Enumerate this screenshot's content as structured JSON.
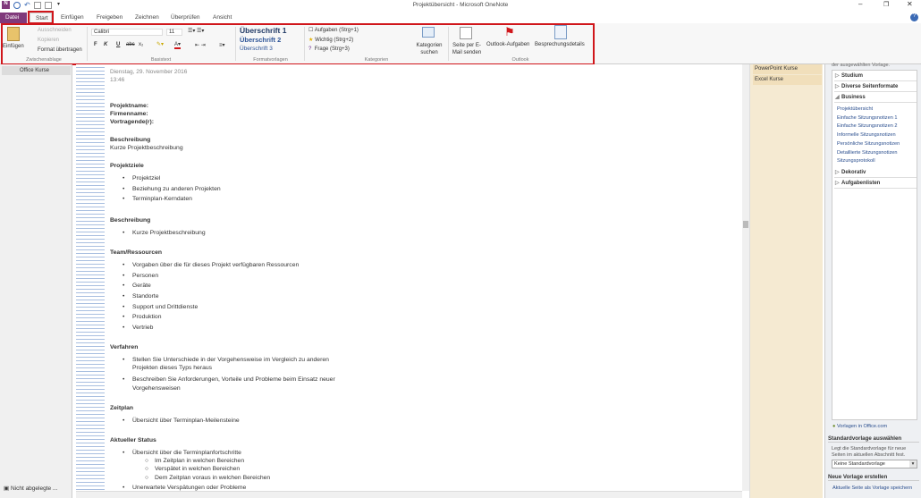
{
  "window": {
    "title": "Projektübersicht - Microsoft OneNote"
  },
  "tabs": [
    {
      "label": "Datei"
    },
    {
      "label": "Start"
    },
    {
      "label": "Einfügen"
    },
    {
      "label": "Freigeben"
    },
    {
      "label": "Zeichnen"
    },
    {
      "label": "Überprüfen"
    },
    {
      "label": "Ansicht"
    }
  ],
  "ribbon": {
    "clipboard": {
      "paste": "Einfügen",
      "cut": "Ausschneiden",
      "copy": "Kopieren",
      "format": "Format übertragen",
      "label": "Zwischenablage"
    },
    "text": {
      "font": "Calibri",
      "size": "11",
      "bold": "F",
      "italic": "K",
      "underline": "U",
      "strike": "abc",
      "sub": "x₂",
      "label": "Basistext"
    },
    "styles": {
      "h1": "Überschrift 1",
      "h2": "Überschrift 2",
      "h3": "Überschrift 3",
      "label": "Formatvorlagen"
    },
    "tags": {
      "t1": "Aufgaben (Strg+1)",
      "t2": "Wichtig (Strg+2)",
      "t3": "Frage (Strg+3)",
      "find": "Kategorien suchen",
      "label": "Kategorien"
    },
    "outlook": {
      "email": "Seite per E-Mail senden",
      "tasks": "Outlook-Aufgaben",
      "meeting": "Besprechungsdetails",
      "label": "Outlook"
    },
    "accent": "#d0161b",
    "file_tab_color": "#80397b"
  },
  "sidebar": {
    "notebook": "Office Kurse",
    "unfiled": "Nicht abgelegte ..."
  },
  "page": {
    "date": "Dienstag, 29. November 2016",
    "time": "13:46",
    "lines": [
      {
        "t": "Projektname:",
        "k": "h"
      },
      {
        "t": "Firmenname:",
        "k": "h"
      },
      {
        "t": "Vortragende(r):",
        "k": "h"
      },
      {
        "t": "Beschreibung",
        "k": "h"
      },
      {
        "t": "Kurze Projektbeschreibung",
        "k": "p"
      },
      {
        "t": "Projektziele",
        "k": "h"
      },
      {
        "t": "Projektziel",
        "k": "b"
      },
      {
        "t": "Beziehung zu anderen Projekten",
        "k": "b"
      },
      {
        "t": "Terminplan-Kerndaten",
        "k": "b"
      },
      {
        "t": "Beschreibung",
        "k": "h"
      },
      {
        "t": "Kurze Projektbeschreibung",
        "k": "b"
      },
      {
        "t": "Team/Ressourcen",
        "k": "h"
      },
      {
        "t": "Vorgaben über die für dieses Projekt verfügbaren Ressourcen",
        "k": "b"
      },
      {
        "t": "Personen",
        "k": "b"
      },
      {
        "t": "Geräte",
        "k": "b"
      },
      {
        "t": "Standorte",
        "k": "b"
      },
      {
        "t": "Support und Drittdienste",
        "k": "b"
      },
      {
        "t": "Produktion",
        "k": "b"
      },
      {
        "t": "Vertrieb",
        "k": "b"
      },
      {
        "t": "Verfahren",
        "k": "h"
      },
      {
        "t": "Stellen Sie Unterschiede in der Vorgehensweise im Vergleich zu anderen",
        "k": "b"
      },
      {
        "t": "Projekten dieses Typs heraus",
        "k": "c"
      },
      {
        "t": "Beschreiben Sie Anforderungen, Vorteile und Probleme beim Einsatz neuer",
        "k": "b"
      },
      {
        "t": "Vorgehensweisen",
        "k": "c"
      },
      {
        "t": "Zeitplan",
        "k": "h"
      },
      {
        "t": "Übersicht über Terminplan-Meilensteine",
        "k": "b"
      },
      {
        "t": "Aktueller Status",
        "k": "h"
      },
      {
        "t": "Übersicht über die Terminplanfortschritte",
        "k": "b"
      },
      {
        "t": "Im Zeitplan in welchen Bereichen",
        "k": "s"
      },
      {
        "t": "Verspätet in welchen Bereichen",
        "k": "s"
      },
      {
        "t": "Dem Zeitplan voraus in welchen Bereichen",
        "k": "s"
      },
      {
        "t": "Unerwartete Verspätungen oder Probleme",
        "k": "b"
      }
    ]
  },
  "page_tabs": [
    {
      "label": "PowerPoint Kurse"
    },
    {
      "label": "Excel Kurse"
    }
  ],
  "pane": {
    "intro": "der ausgewählten Vorlage.",
    "categories": [
      {
        "label": "Studium",
        "open": false
      },
      {
        "label": "Diverse Seitenformate",
        "open": false
      },
      {
        "label": "Business",
        "open": true
      }
    ],
    "business": [
      "Projektübersicht",
      "Einfache Sitzungsnotizen 1",
      "Einfache Sitzungsnotizen 2",
      "Informelle Sitzungsnotizen",
      "Persönliche Sitzungsnotizen",
      "Detaillierte Sitzungsnotizen",
      "Sitzungsprotokoll"
    ],
    "categories2": [
      {
        "label": "Dekorativ"
      },
      {
        "label": "Aufgabenlisten"
      }
    ],
    "office_link": "Vorlagen in Office.com",
    "default_heading": "Standardvorlage auswählen",
    "default_desc": "Legt die Standardvorlage für neue Seiten im aktuellen Abschnitt fest.",
    "default_value": "Keine Standardvorlage",
    "new_heading": "Neue Vorlage erstellen",
    "save_link": "Aktuelle Seite als Vorlage speichern"
  }
}
